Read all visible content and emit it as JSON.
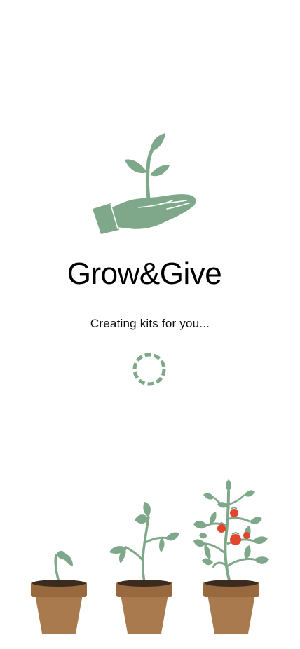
{
  "app": {
    "title": "Grow&Give",
    "status": "Creating kits for you..."
  },
  "logo": {
    "icon": "hand-holding-sprout-icon"
  },
  "loader": {
    "icon": "loading-spinner-icon",
    "state": "loading"
  },
  "illustration": {
    "stages": [
      "seedling",
      "young-plant",
      "tomato-plant"
    ]
  },
  "colors": {
    "accent_green": "#7ea889",
    "pot_brown": "#a87a4e",
    "pot_rim": "#98693e",
    "soil": "#3b2a1e",
    "tomato_red": "#e2452e",
    "text": "#000000"
  }
}
